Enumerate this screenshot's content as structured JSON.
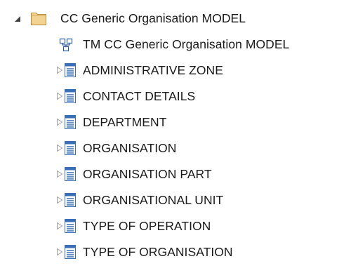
{
  "tree": {
    "root": {
      "label": "CC Generic Organisation MODEL",
      "expanded": true,
      "icon": "folder-icon"
    },
    "diagram": {
      "label": "TM CC Generic Organisation MODEL",
      "icon": "diagram-icon"
    },
    "items": [
      {
        "label": "ADMINISTRATIVE ZONE",
        "icon": "table-icon",
        "expanded": false
      },
      {
        "label": "CONTACT DETAILS",
        "icon": "table-icon",
        "expanded": false
      },
      {
        "label": "DEPARTMENT",
        "icon": "table-icon",
        "expanded": false
      },
      {
        "label": "ORGANISATION",
        "icon": "table-icon",
        "expanded": false
      },
      {
        "label": "ORGANISATION PART",
        "icon": "table-icon",
        "expanded": false
      },
      {
        "label": "ORGANISATIONAL UNIT",
        "icon": "table-icon",
        "expanded": false
      },
      {
        "label": "TYPE OF OPERATION",
        "icon": "table-icon",
        "expanded": false
      },
      {
        "label": "TYPE OF ORGANISATION",
        "icon": "table-icon",
        "expanded": false
      }
    ]
  },
  "colors": {
    "folder_fill": "#f3d394",
    "folder_stroke": "#b98a3a",
    "table_blue": "#3a6fb5",
    "twisty_expanded": "#404040",
    "twisty_collapsed": "#a0a0a0"
  }
}
